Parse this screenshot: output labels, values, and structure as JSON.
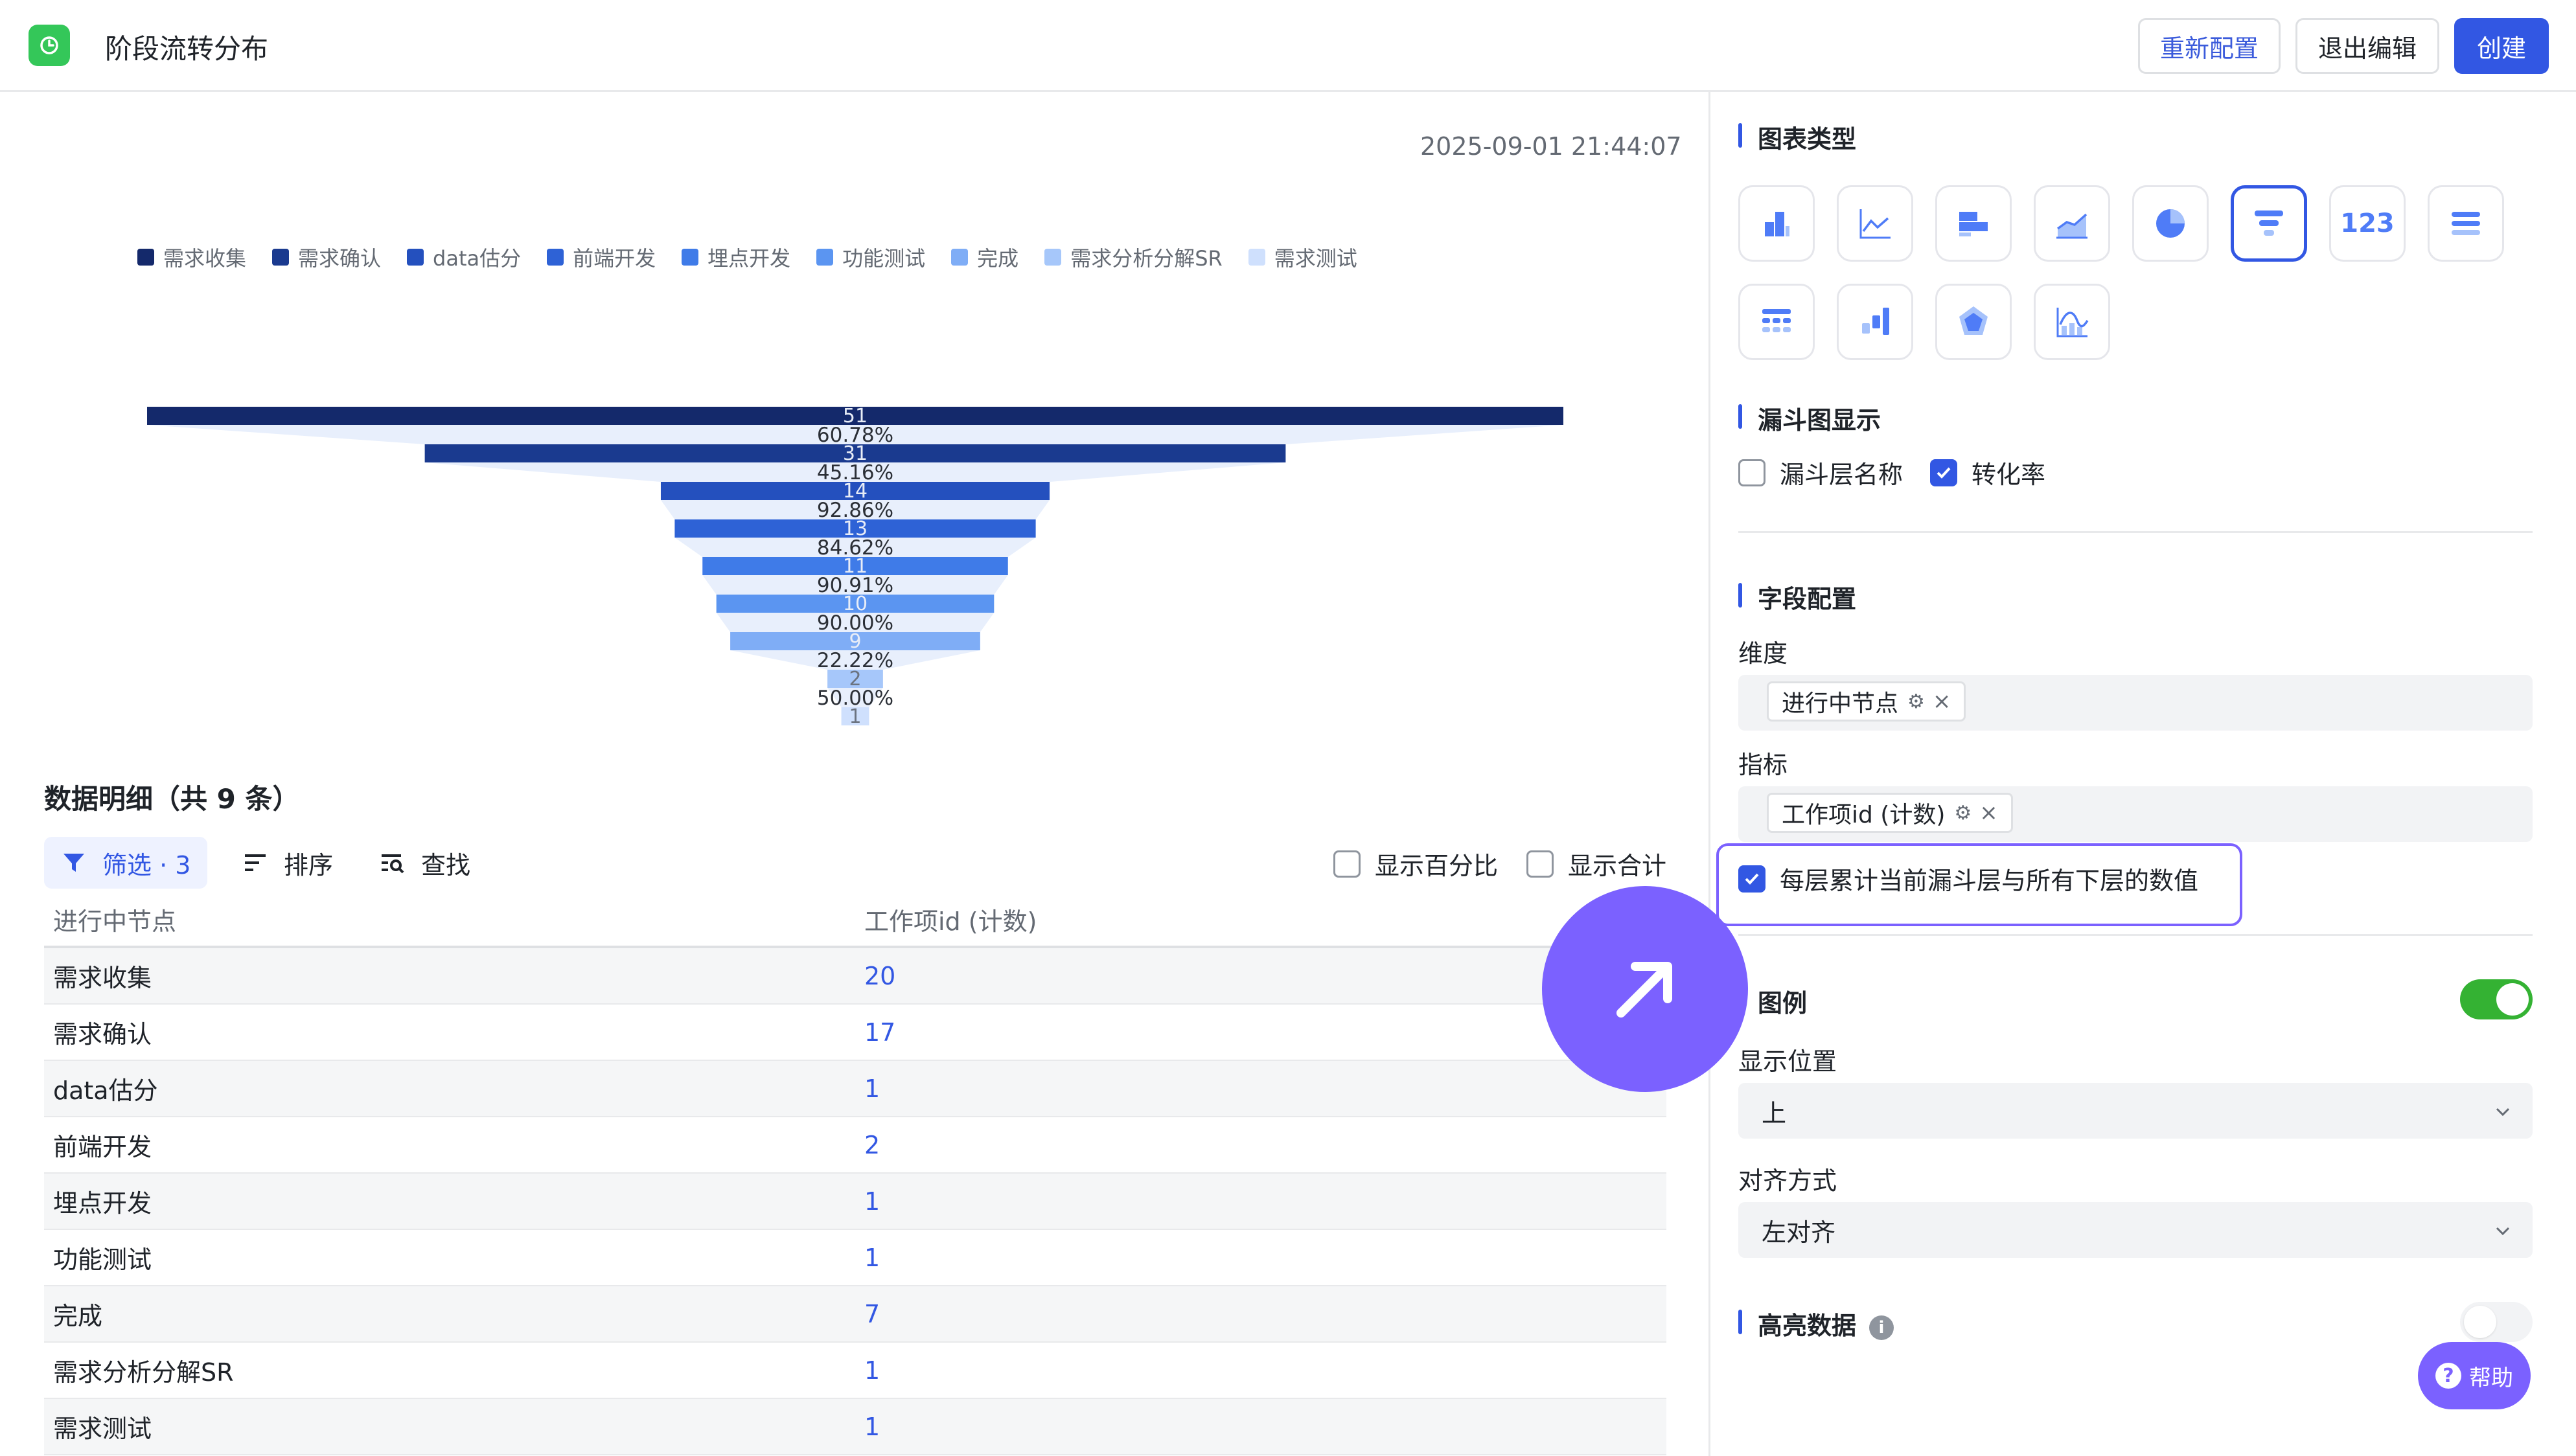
{
  "header": {
    "title": "阶段流转分布",
    "reconfig_label": "重新配置",
    "exit_label": "退出编辑",
    "create_label": "创建"
  },
  "chart_area": {
    "timestamp": "2025-09-01 21:44:07"
  },
  "chart_data": {
    "type": "funnel",
    "categories": [
      "需求收集",
      "需求确认",
      "data估分",
      "前端开发",
      "埋点开发",
      "功能测试",
      "完成",
      "需求分析分解SR",
      "需求测试"
    ],
    "values": [
      51,
      31,
      14,
      13,
      11,
      10,
      9,
      2,
      1
    ],
    "conversion_rates": [
      "60.78%",
      "45.16%",
      "92.86%",
      "84.62%",
      "90.91%",
      "90.00%",
      "22.22%",
      "50.00%"
    ],
    "colors": [
      "#14296b",
      "#1a3a8f",
      "#2450be",
      "#2e62d6",
      "#3f7be8",
      "#5b95f1",
      "#7fadf6",
      "#a6c7fa",
      "#cfe0fd"
    ],
    "legend_position": "top-left"
  },
  "detail": {
    "title": "数据明细（共 9 条）",
    "filter_label": "筛选 · 3",
    "sort_label": "排序",
    "find_label": "查找",
    "show_percent_label": "显示百分比",
    "show_total_label": "显示合计",
    "columns": [
      "进行中节点",
      "工作项id (计数)"
    ],
    "rows": [
      [
        "需求收集",
        "20"
      ],
      [
        "需求确认",
        "17"
      ],
      [
        "data估分",
        "1"
      ],
      [
        "前端开发",
        "2"
      ],
      [
        "埋点开发",
        "1"
      ],
      [
        "功能测试",
        "1"
      ],
      [
        "完成",
        "7"
      ],
      [
        "需求分析分解SR",
        "1"
      ],
      [
        "需求测试",
        "1"
      ]
    ]
  },
  "config": {
    "chart_type_title": "图表类型",
    "chart_type_number_label": "123",
    "funnel_display_title": "漏斗图显示",
    "show_layer_name_label": "漏斗层名称",
    "conversion_rate_label": "转化率",
    "field_config_title": "字段配置",
    "dimension_label": "维度",
    "dimension_tag": "进行中节点",
    "metric_label": "指标",
    "metric_tag": "工作项id (计数)",
    "cumulative_label": "每层累计当前漏斗层与所有下层的数值",
    "legend_label": "图例",
    "position_label": "显示位置",
    "position_value": "上",
    "align_label": "对齐方式",
    "align_value": "左对齐",
    "highlight_label": "高亮数据",
    "help_label": "帮助"
  }
}
